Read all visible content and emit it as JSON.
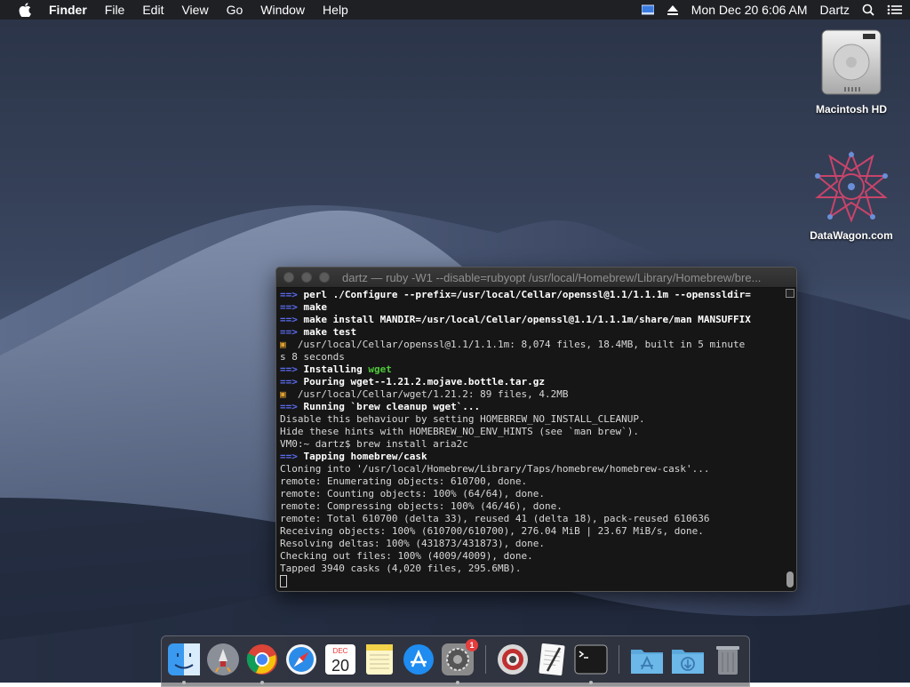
{
  "menubar": {
    "app_name": "Finder",
    "items": [
      "File",
      "Edit",
      "View",
      "Go",
      "Window",
      "Help"
    ],
    "clock": "Mon Dec 20  6:06 AM",
    "user": "Dartz"
  },
  "desktop_icons": {
    "hd_label": "Macintosh HD",
    "datawagon_label": "DataWagon.com"
  },
  "terminal": {
    "title": "dartz — ruby -W1 --disable=rubyopt /usr/local/Homebrew/Library/Homebrew/bre...",
    "lines": [
      {
        "t": "arrow",
        "text": "perl ./Configure --prefix=/usr/local/Cellar/openssl@1.1/1.1.1m --openssldir="
      },
      {
        "t": "arrow",
        "text": "make"
      },
      {
        "t": "arrow",
        "text": "make install MANDIR=/usr/local/Cellar/openssl@1.1/1.1.1m/share/man MANSUFFIX"
      },
      {
        "t": "arrow",
        "text": "make test"
      },
      {
        "t": "mug",
        "text": "/usr/local/Cellar/openssl@1.1/1.1.1m: 8,074 files, 18.4MB, built in 5 minute"
      },
      {
        "t": "plain",
        "text": "s 8 seconds"
      },
      {
        "t": "arrow-g",
        "text": "Installing ",
        "extra": "wget"
      },
      {
        "t": "arrow",
        "text": "Pouring wget--1.21.2.mojave.bottle.tar.gz"
      },
      {
        "t": "mug",
        "text": "/usr/local/Cellar/wget/1.21.2: 89 files, 4.2MB"
      },
      {
        "t": "arrow",
        "text": "Running `brew cleanup wget`..."
      },
      {
        "t": "plain",
        "text": "Disable this behaviour by setting HOMEBREW_NO_INSTALL_CLEANUP."
      },
      {
        "t": "plain",
        "text": "Hide these hints with HOMEBREW_NO_ENV_HINTS (see `man brew`)."
      },
      {
        "t": "prompt",
        "text": "VM0:~ dartz$ brew install aria2c"
      },
      {
        "t": "arrow",
        "text": "Tapping homebrew/cask"
      },
      {
        "t": "plain",
        "text": "Cloning into '/usr/local/Homebrew/Library/Taps/homebrew/homebrew-cask'..."
      },
      {
        "t": "plain",
        "text": "remote: Enumerating objects: 610700, done."
      },
      {
        "t": "plain",
        "text": "remote: Counting objects: 100% (64/64), done."
      },
      {
        "t": "plain",
        "text": "remote: Compressing objects: 100% (46/46), done."
      },
      {
        "t": "plain",
        "text": "remote: Total 610700 (delta 33), reused 41 (delta 18), pack-reused 610636"
      },
      {
        "t": "plain",
        "text": "Receiving objects: 100% (610700/610700), 276.04 MiB | 23.67 MiB/s, done."
      },
      {
        "t": "plain",
        "text": "Resolving deltas: 100% (431873/431873), done."
      },
      {
        "t": "plain",
        "text": "Checking out files: 100% (4009/4009), done."
      },
      {
        "t": "plain",
        "text": "Tapped 3940 casks (4,020 files, 295.6MB)."
      }
    ]
  },
  "dock": {
    "items": [
      "finder-icon",
      "launchpad-icon",
      "chrome-icon",
      "safari-icon",
      "calendar-icon",
      "notes-icon",
      "app-store-icon",
      "system-preferences-icon",
      "photo-booth-icon",
      "textedit-icon",
      "terminal-icon",
      "applications-folder-icon",
      "downloads-folder-icon",
      "trash-icon"
    ],
    "calendar_month": "DEC",
    "calendar_day": "20",
    "sysprefs_badge": "1"
  }
}
